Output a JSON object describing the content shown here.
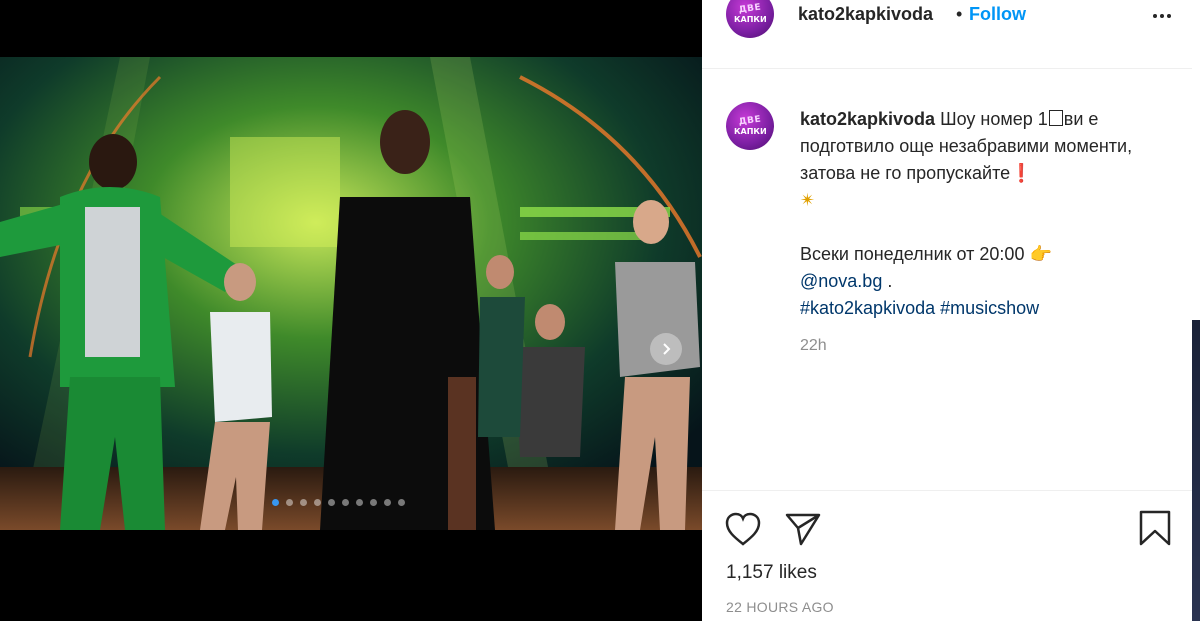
{
  "post": {
    "username": "kato2kapkivoda",
    "separator": "•",
    "follow_label": "Follow",
    "more_icon": "more-horizontal-icon",
    "avatar_text_line1": "ДВЕ",
    "avatar_text_line2": "КАПКИ",
    "caption": {
      "username": "kato2kapkivoda",
      "text_part1": "Шоу номер 1",
      "text_part2": "ви е подготвило още незабравими моменти, затова не го пропускайте",
      "exclaim": "❗",
      "sparkle": "✴",
      "line2": "Всеки понеделник от 20:00",
      "point": "👉",
      "mention": "@nova.bg",
      "mention_suffix": " .",
      "hashtag1": "#kato2kapkivoda",
      "hashtag2": "#musicshow"
    },
    "caption_time": "22h",
    "likes": "1,157 likes",
    "posted_ago": "22 HOURS AGO"
  },
  "media": {
    "carousel_dots": 10,
    "active_dot": 0,
    "accent": "#3897f0"
  },
  "colors": {
    "follow": "#0095f6",
    "link": "#00376b",
    "muted": "#8e8e8e"
  }
}
